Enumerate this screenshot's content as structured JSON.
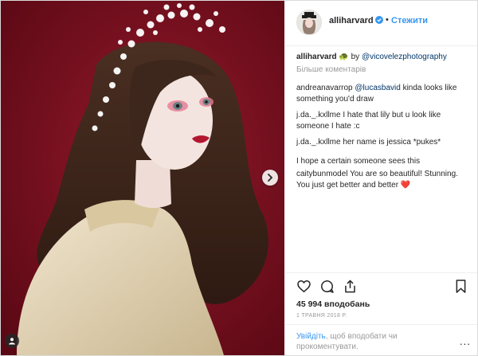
{
  "post": {
    "username": "alliharvard",
    "follow_label": "Стежити",
    "dot": "•",
    "caption_emoji": "🐢",
    "caption_by": "by",
    "caption_mention": "@vicovelezphotography",
    "more_comments_label": "Більше коментарів"
  },
  "comments": [
    {
      "user": "andreanavarrop",
      "mention": "@lucasbavid",
      "text": " kinda looks like something you'd draw"
    },
    {
      "user": "j.da._.kxllme",
      "mention": "",
      "text": " I hate that lily but u look like someone I hate :c"
    },
    {
      "user": "j.da._.kxllme",
      "mention": "",
      "text": " her name is jessica *pukes*"
    },
    {
      "user": "",
      "mention": "",
      "text": "I hope a certain someone sees this"
    },
    {
      "user": "caitybunmodel",
      "mention": "",
      "text": " You are so beautiful! Stunning. You just get better and better ❤️"
    }
  ],
  "likes_text": "45 994 вподобань",
  "date_text": "1 ТРАВНЯ 2018 Р.",
  "login": {
    "link_label": "Увійдіть",
    "rest_text": ", щоб вподобати чи прокоментувати."
  },
  "options_label": "...",
  "icons": {
    "like": "heart-icon",
    "comment": "comment-icon",
    "share": "share-icon",
    "save": "bookmark-icon",
    "next": "chevron-right-icon",
    "verified": "verified-badge-icon"
  },
  "colors": {
    "background_red": "#7b0f1f",
    "link_blue": "#3897f0",
    "text": "#262626",
    "muted": "#999999"
  }
}
